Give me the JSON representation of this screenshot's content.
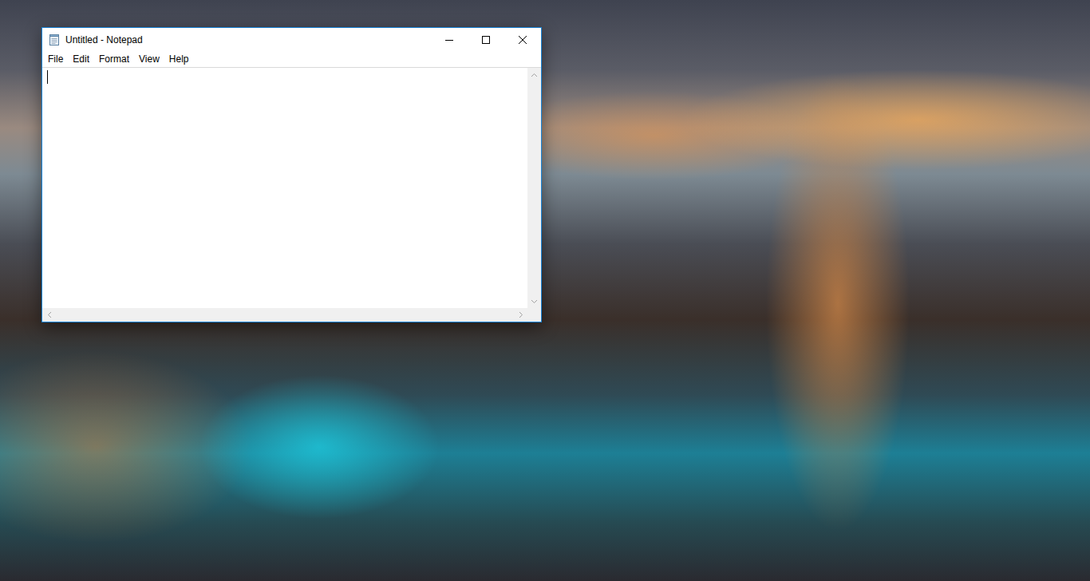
{
  "window": {
    "title": "Untitled - Notepad",
    "active": true
  },
  "menu": [
    {
      "label": "File"
    },
    {
      "label": "Edit"
    },
    {
      "label": "Format"
    },
    {
      "label": "View"
    },
    {
      "label": "Help"
    }
  ],
  "editor": {
    "text": "",
    "focused": true
  }
}
